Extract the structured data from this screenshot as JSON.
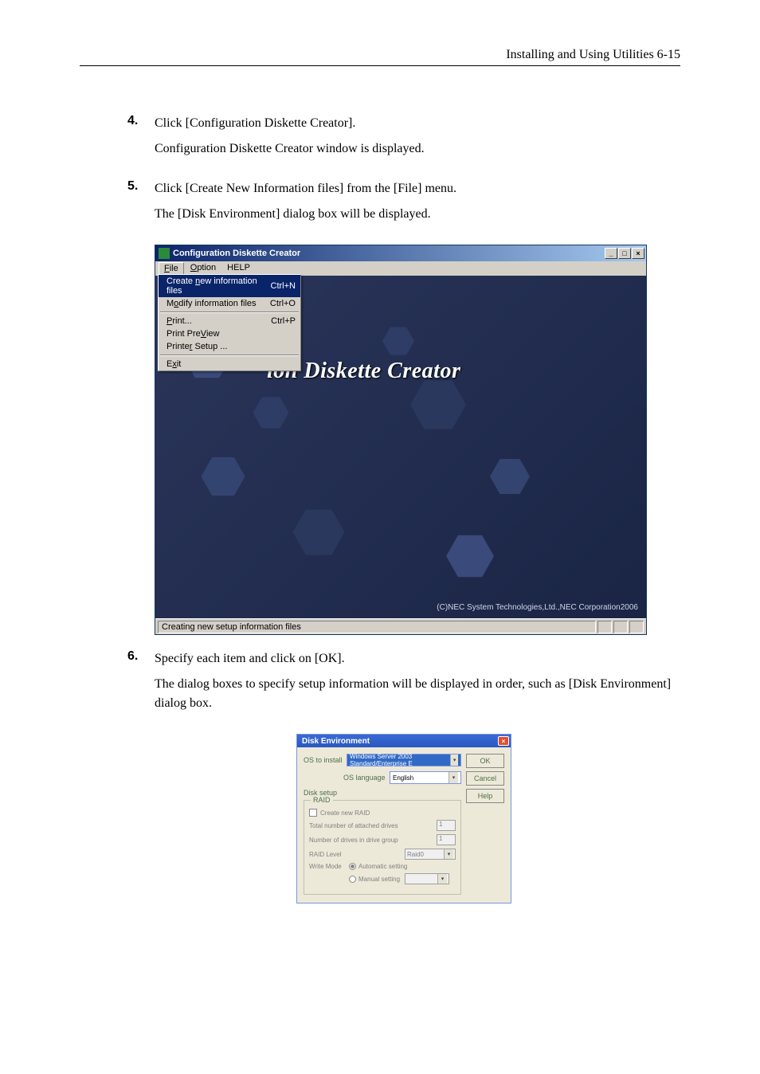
{
  "header": {
    "text": "Installing and Using Utilities   6-15"
  },
  "steps": {
    "s4": {
      "num": "4.",
      "line1": "Click [Configuration Diskette Creator].",
      "line2": "Configuration Diskette Creator window is displayed."
    },
    "s5": {
      "num": "5.",
      "line1": "Click [Create New Information files] from the [File] menu.",
      "line2": "The [Disk Environment] dialog box will be displayed."
    },
    "s6": {
      "num": "6.",
      "line1": "Specify each item and click on [OK].",
      "line2": "The dialog boxes to specify setup information will be displayed in order, such as [Disk Environment] dialog box."
    }
  },
  "screenshot1": {
    "title": "Configuration Diskette Creator",
    "menus": {
      "file": "File",
      "option": "Option",
      "help": "HELP"
    },
    "file_menu": {
      "create": {
        "label": "Create new information files",
        "accel": "Ctrl+N"
      },
      "modify": {
        "label": "Modify information files",
        "accel": "Ctrl+O"
      },
      "print": {
        "label": "Print...",
        "accel": "Ctrl+P"
      },
      "preview": {
        "label": "Print PreView"
      },
      "setup": {
        "label": "Printer Setup ..."
      },
      "exit": {
        "label": "Exit"
      }
    },
    "body_title": "ion Diskette Creator",
    "copyright": "(C)NEC System Technologies,Ltd.,NEC Corporation2006",
    "status": "Creating new setup information files"
  },
  "screenshot2": {
    "title": "Disk Environment",
    "os_install_label": "OS to install",
    "os_install_value": "Windows Server 2003 Standard/Enterprise E",
    "os_lang_label": "OS language",
    "os_lang_value": "English",
    "buttons": {
      "ok": "OK",
      "cancel": "Cancel",
      "help": "Help"
    },
    "disk_setup_label": "Disk setup",
    "raid_group": "RAID",
    "create_raid": "Create new RAID",
    "total_drives": "Total number of attached drives",
    "total_drives_val": "1",
    "num_drives_group": "Number of drives in drive group",
    "num_drives_group_val": "1",
    "raid_level": "RAID Level",
    "raid_level_val": "Raid0",
    "write_mode": "Write Mode",
    "auto": "Automatic setting",
    "manual": "Manual setting"
  }
}
